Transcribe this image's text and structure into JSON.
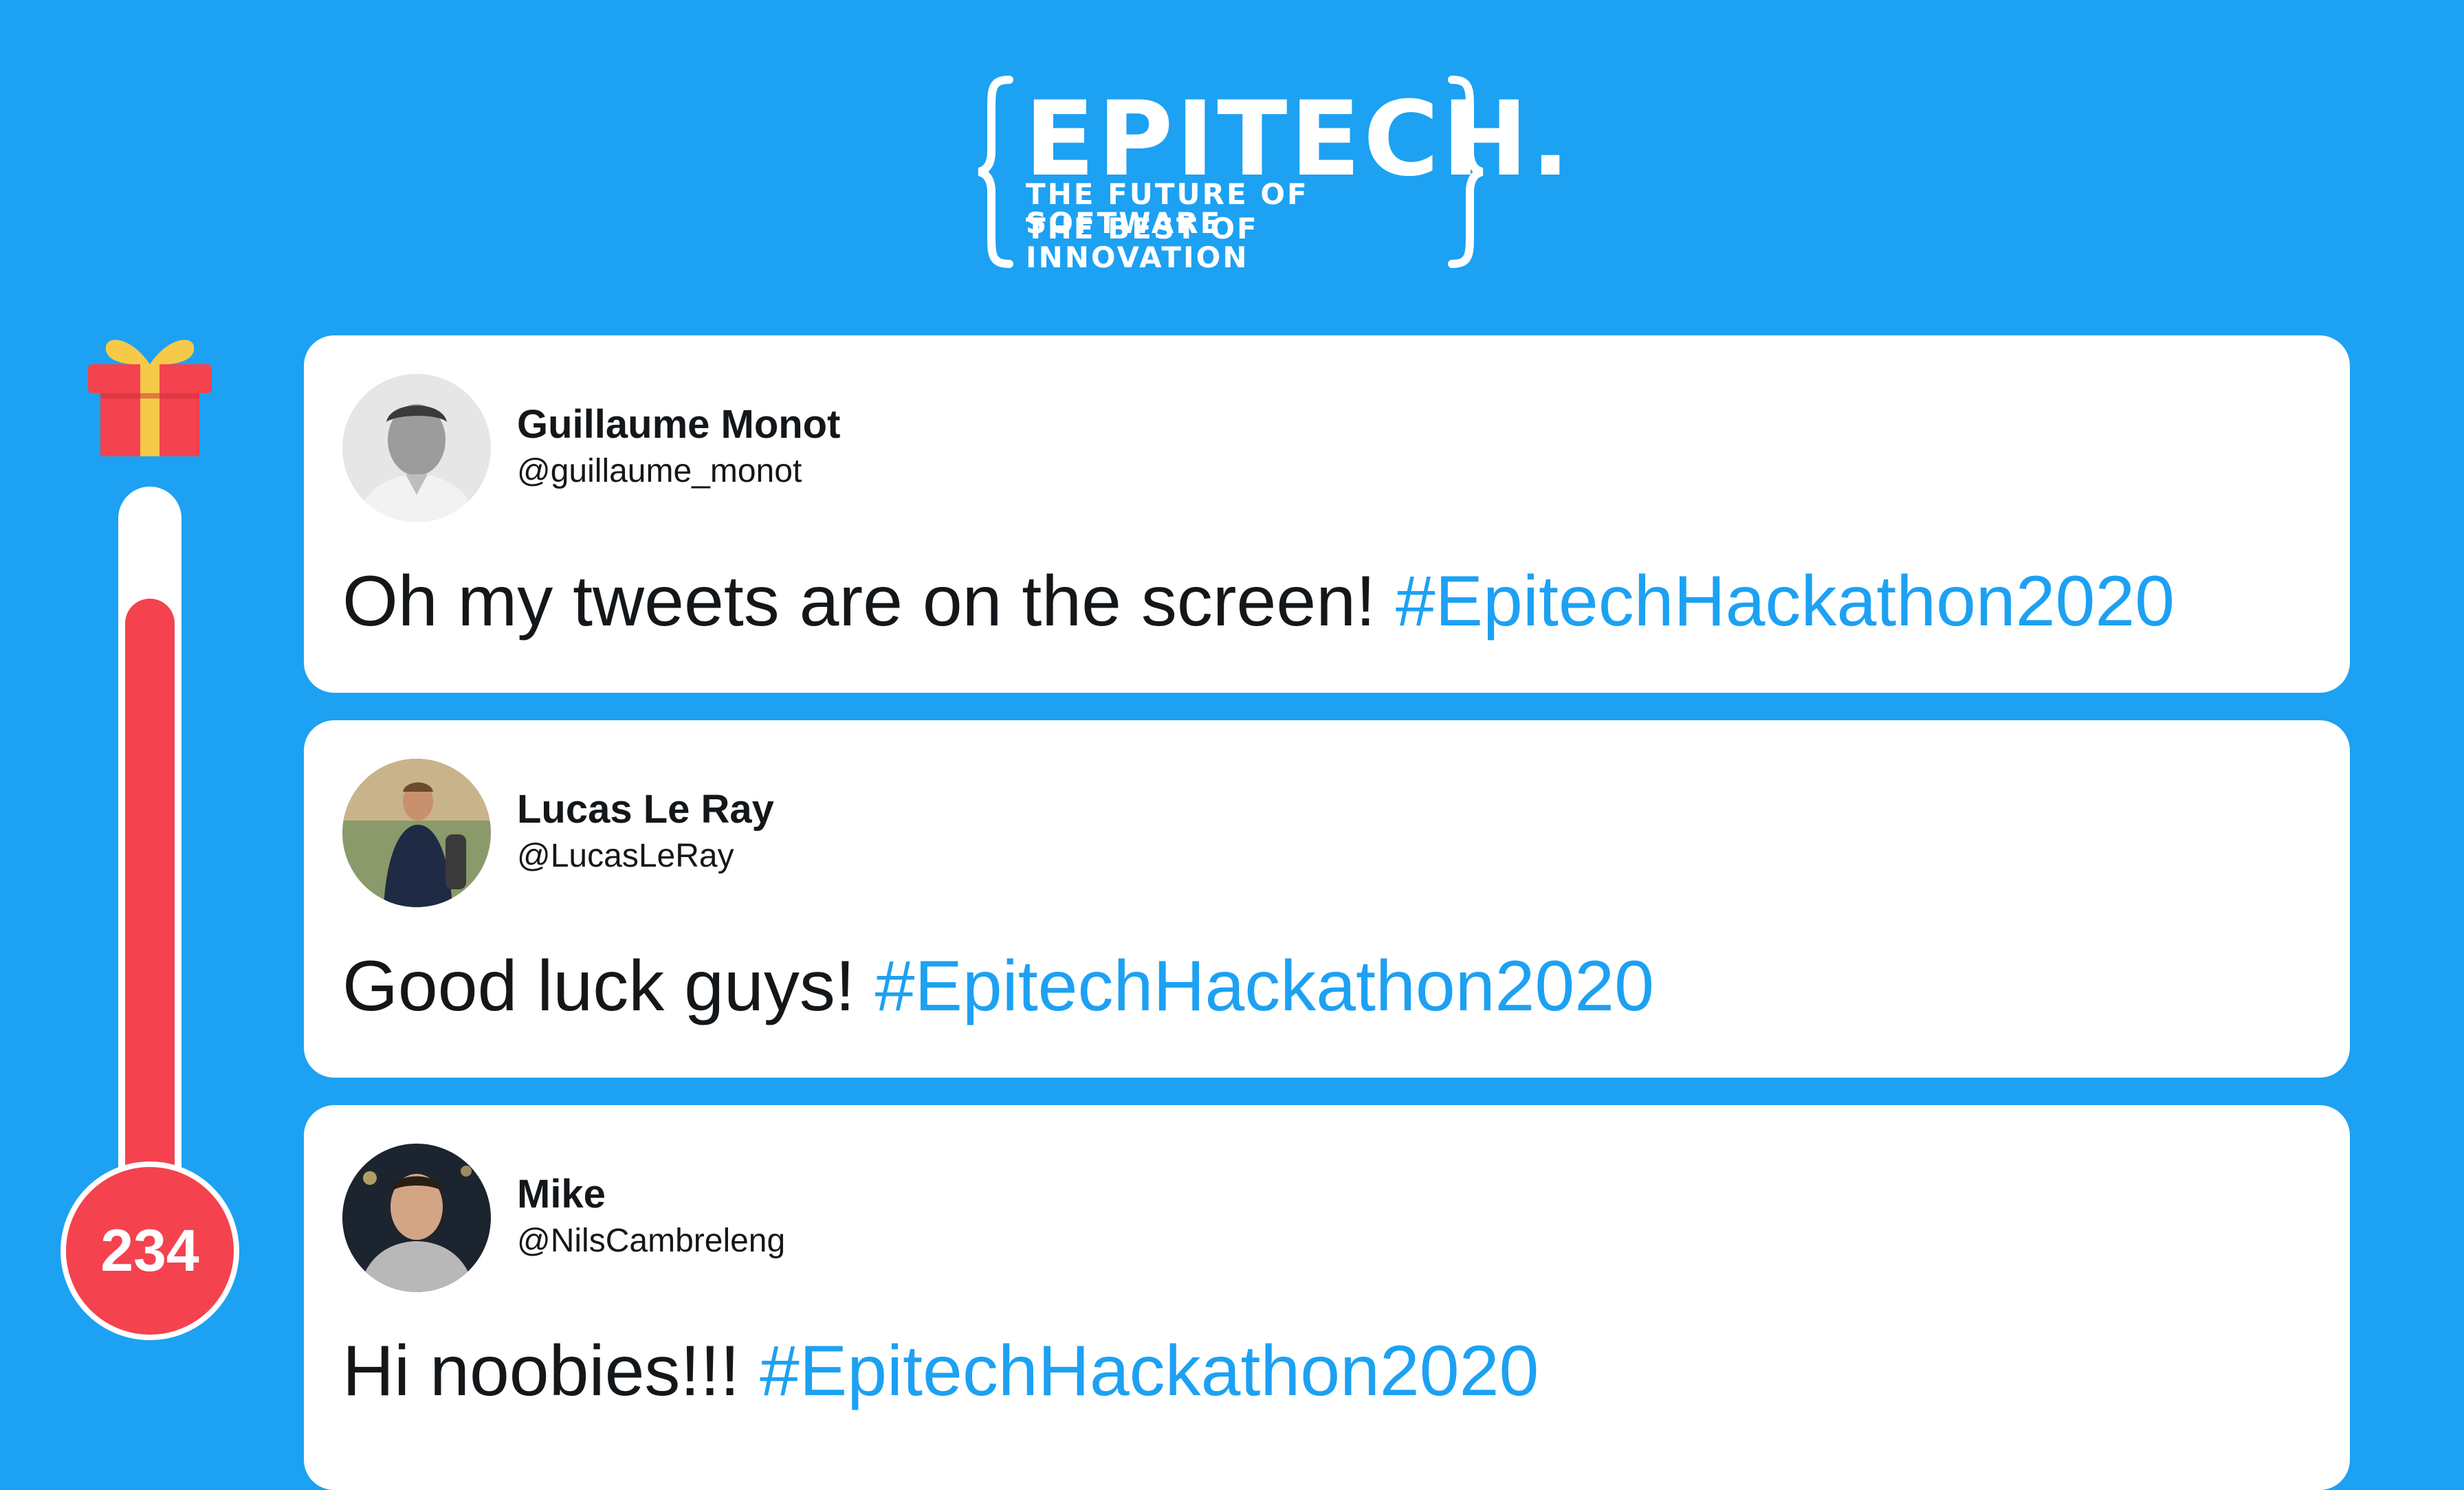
{
  "logo": {
    "word": "EPITECH.",
    "line1": "THE FUTURE OF SOFTWARE",
    "line2": "THE BEST OF INNOVATION"
  },
  "thermometer": {
    "count": "234",
    "level_percent": 85
  },
  "tweets": [
    {
      "name": "Guillaume Monot",
      "handle": "@guillaume_monot",
      "text": "Oh my tweets are on the screen! ",
      "hashtag": "#EpitechHackathon2020"
    },
    {
      "name": "Lucas Le Ray",
      "handle": "@LucasLeRay",
      "text": "Good luck guys! ",
      "hashtag": "#EpitechHackathon2020"
    },
    {
      "name": "Mike",
      "handle": "@NilsCambreleng",
      "text": "Hi noobies!!! ",
      "hashtag": "#EpitechHackathon2020"
    }
  ],
  "colors": {
    "background": "#1da1f2",
    "hashtag": "#1da1f2",
    "thermometer_fill": "#f5424f"
  }
}
